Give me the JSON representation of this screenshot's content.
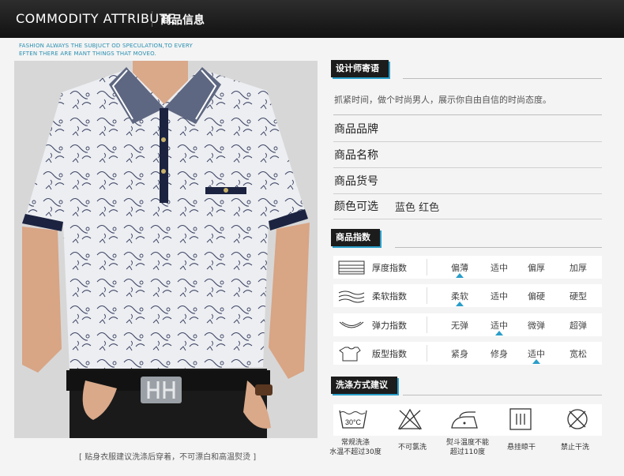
{
  "header": {
    "title_en": "COMMODITY ATTRIBUTE",
    "title_cn": "商品信息"
  },
  "tagline": {
    "line1": "FASHION ALWAYS THE  SUBJUCT OD SPECULATION,TO EVERY",
    "line2": "EFTEN THERE ARE MANT THINGS THAT MOVEO."
  },
  "designer": {
    "label": "设计师寄语",
    "text": "抓紧时间，做个时尚男人，展示你自由自信的时尚态度。"
  },
  "info": [
    {
      "key": "商品品牌",
      "value": ""
    },
    {
      "key": "商品名称",
      "value": ""
    },
    {
      "key": "商品货号",
      "value": ""
    },
    {
      "key": "颜色可选",
      "value": "蓝色 红色"
    }
  ],
  "index_section": {
    "label": "商品指数"
  },
  "indexes": [
    {
      "icon": "thickness-icon",
      "name": "厚度指数",
      "options": [
        "偏薄",
        "适中",
        "偏厚",
        "加厚"
      ],
      "selected": 0
    },
    {
      "icon": "softness-icon",
      "name": "柔软指数",
      "options": [
        "柔软",
        "适中",
        "偏硬",
        "硬型"
      ],
      "selected": 0
    },
    {
      "icon": "elasticity-icon",
      "name": "弹力指数",
      "options": [
        "无弹",
        "适中",
        "微弹",
        "超弹"
      ],
      "selected": 1
    },
    {
      "icon": "fit-icon",
      "name": "版型指数",
      "options": [
        "紧身",
        "修身",
        "适中",
        "宽松"
      ],
      "selected": 2
    }
  ],
  "wash": {
    "label": "洗涤方式建议",
    "items": [
      {
        "icon": "wash-30c-icon",
        "icon_text": "30°C",
        "line1": "常规洗涤",
        "line2": "水温不超过30度"
      },
      {
        "icon": "no-bleach-icon",
        "line1": "不可氯洗",
        "line2": ""
      },
      {
        "icon": "iron-icon",
        "line1": "熨斗温度不能",
        "line2": "超过110度"
      },
      {
        "icon": "hang-dry-icon",
        "line1": "悬挂晾干",
        "line2": ""
      },
      {
        "icon": "no-dry-clean-icon",
        "line1": "禁止干洗",
        "line2": ""
      }
    ]
  },
  "caption": "[ 贴身衣服建议洗涤后穿着，不可漂白和高温熨烫 ]",
  "colors": {
    "accent": "#2a9ec9",
    "label_bg": "#1c1c1c",
    "header_bg": "#1a1a1a"
  }
}
